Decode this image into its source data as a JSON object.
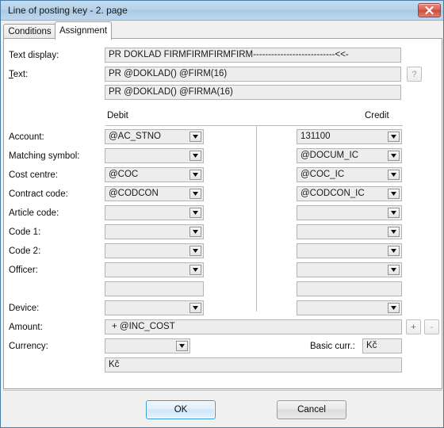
{
  "window": {
    "title": "Line of posting key - 2. page",
    "close_label": "close-window"
  },
  "tabs": [
    {
      "label": "Conditions",
      "active": false
    },
    {
      "label": "Assignment",
      "active": true
    }
  ],
  "top_fields": {
    "text_display_label": "Text display:",
    "text_display_value": "PR DOKLAD FIRMFIRMFIRMFIRM---------------------------<<-",
    "text_label_prefix": "T",
    "text_label_rest": "ext:",
    "text_value": "PR @DOKLAD() @FIRM(16)",
    "text_second_value": "PR @DOKLAD() @FIRMA(16)",
    "help_button_label": "?"
  },
  "columns": {
    "debit_header": "Debit",
    "credit_header": "Credit"
  },
  "rows": [
    {
      "label": "Account:",
      "type": "combo",
      "debit": "@AC_STNO",
      "credit": "131100"
    },
    {
      "label": "Matching symbol:",
      "type": "combo",
      "debit": "",
      "credit": "@DOCUM_IC"
    },
    {
      "label": "Cost centre:",
      "type": "combo",
      "debit": "@COC",
      "credit": "@COC_IC"
    },
    {
      "label": "Contract code:",
      "type": "combo",
      "debit": "@CODCON",
      "credit": "@CODCON_IC"
    },
    {
      "label": "Article code:",
      "type": "combo",
      "debit": "",
      "credit": ""
    },
    {
      "label": "Code 1:",
      "type": "combo",
      "debit": "",
      "credit": ""
    },
    {
      "label": "Code 2:",
      "type": "combo",
      "debit": "",
      "credit": ""
    },
    {
      "label": "Officer:",
      "type": "combo",
      "debit": "",
      "credit": ""
    },
    {
      "label": "",
      "type": "text",
      "debit": "",
      "credit": ""
    },
    {
      "label": "Device:",
      "type": "combo",
      "debit": "",
      "credit": ""
    }
  ],
  "amount": {
    "label": "Amount:",
    "value": "+ @INC_COST",
    "plus_button": "+",
    "minus_button": "-"
  },
  "currency": {
    "label": "Currency:",
    "value": "",
    "basic_label": "Basic curr.:",
    "basic_value": "Kč",
    "note_value": "Kč"
  },
  "buttons": {
    "ok": "OK",
    "cancel": "Cancel"
  },
  "colors": {
    "title_bar": "#b7d2e9",
    "window_border": "#4a7ba7",
    "close_button": "#c94a3c",
    "field_bg": "#ededed",
    "field_border": "#b4b4b4",
    "default_button_border": "#3c9cd6"
  }
}
